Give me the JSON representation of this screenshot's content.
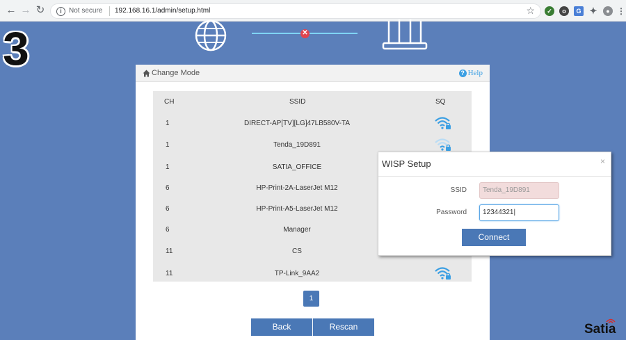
{
  "browser": {
    "security_label": "Not secure",
    "url": "192.168.16.1/admin/setup.html"
  },
  "step_number": "3",
  "connection_status": {
    "link": "failed"
  },
  "panel": {
    "change_mode_label": "Change Mode",
    "help_label": "Help",
    "table": {
      "headers": {
        "ch": "CH",
        "ssid": "SSID",
        "sq": "SQ"
      },
      "rows": [
        {
          "ch": "1",
          "ssid": "DIRECT-AP[TV][LG]47LB580V-TA",
          "signal": "strong-locked"
        },
        {
          "ch": "1",
          "ssid": "Tenda_19D891",
          "signal": "weak-locked"
        },
        {
          "ch": "1",
          "ssid": "SATIA_OFFICE",
          "signal": ""
        },
        {
          "ch": "6",
          "ssid": "HP-Print-2A-LaserJet M12",
          "signal": ""
        },
        {
          "ch": "6",
          "ssid": "HP-Print-A5-LaserJet M12",
          "signal": ""
        },
        {
          "ch": "6",
          "ssid": "Manager",
          "signal": ""
        },
        {
          "ch": "11",
          "ssid": "CS",
          "signal": ""
        },
        {
          "ch": "11",
          "ssid": "TP-Link_9AA2",
          "signal": "strong-locked"
        }
      ]
    },
    "pagination": {
      "current_page": "1"
    },
    "back_label": "Back",
    "rescan_label": "Rescan"
  },
  "wisp_dialog": {
    "title": "WISP Setup",
    "close_label": "×",
    "ssid_label": "SSID",
    "ssid_value": "Tenda_19D891",
    "password_label": "Password",
    "password_value": "12344321",
    "connect_label": "Connect"
  },
  "brand": {
    "name": "Satia"
  },
  "colors": {
    "background": "#5b7fba",
    "button": "#4a78b6",
    "wifi": "#3b9fe3",
    "error": "#e0454f",
    "link_line": "#7fd4f5"
  }
}
